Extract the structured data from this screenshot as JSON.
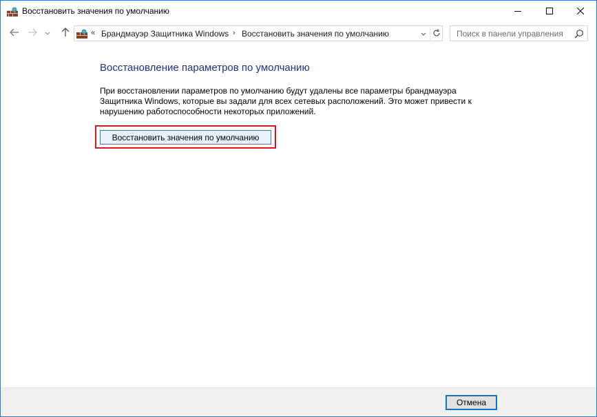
{
  "window": {
    "title": "Восстановить значения по умолчанию",
    "icon": "firewall-icon",
    "controls": {
      "minimize": "minimize-icon",
      "maximize": "maximize-icon",
      "close": "close-icon"
    }
  },
  "navigation": {
    "back_icon": "arrow-left-icon",
    "forward_icon": "arrow-right-icon",
    "recent_icon": "chevron-down-icon",
    "up_icon": "arrow-up-icon",
    "address": {
      "overflow": "«",
      "breadcrumbs": [
        {
          "label": "Брандмауэр Защитника Windows"
        },
        {
          "label": "Восстановить значения по умолчанию"
        }
      ],
      "separator": "›"
    },
    "search": {
      "placeholder": "Поиск в панели управления"
    }
  },
  "main": {
    "heading": "Восстановление параметров по умолчанию",
    "description": "При восстановлении параметров по умолчанию будут удалены все параметры брандмауэра Защитника Windows, которые вы задали для всех сетевых расположений. Это может привести к нарушению работоспособности некоторых приложений.",
    "restore_button_label": "Восстановить значения по умолчанию"
  },
  "footer": {
    "cancel_label": "Отмена"
  },
  "colors": {
    "heading": "#1e3287",
    "highlight": "#d9191c",
    "button_bg": "#e5f1fb",
    "button_border": "#3c7fb1",
    "focus_border": "#0078d7"
  }
}
